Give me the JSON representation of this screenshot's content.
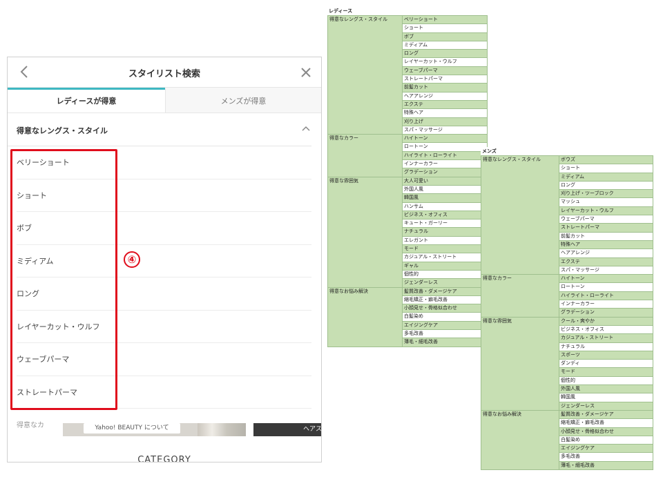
{
  "modal": {
    "title": "スタイリスト検索",
    "tabs": [
      {
        "label": "レディースが得意",
        "active": true
      },
      {
        "label": "メンズが得意",
        "active": false
      }
    ],
    "section_title": "得意なレングス・スタイル",
    "options": [
      "ベリーショート",
      "ショート",
      "ボブ",
      "ミディアム",
      "ロング",
      "レイヤーカット・ウルフ",
      "ウェーブパーマ",
      "ストレートパーマ"
    ],
    "marker": "④",
    "next_section_partial": "得意なカ",
    "footer": {
      "about_label": "Yahoo! BEAUTY について",
      "dark_label": "ヘアス",
      "category_label": "CATEGORY"
    },
    "accent_color": "#3fb8c2",
    "highlight_color": "#e00d1c"
  },
  "ladies_table": {
    "title": "レディース",
    "groups": [
      {
        "category": "得意なレングス・スタイル",
        "items": [
          "ベリーショート",
          "ショート",
          "ボブ",
          "ミディアム",
          "ロング",
          "レイヤーカット・ウルフ",
          "ウェーブパーマ",
          "ストレートパーマ",
          "前髪カット",
          "ヘアアレンジ",
          "エクステ",
          "特殊ヘア",
          "刈り上げ",
          "スパ・マッサージ"
        ]
      },
      {
        "category": "得意なカラー",
        "items": [
          "ハイトーン",
          "ロートーン",
          "ハイライト・ローライト",
          "インナーカラー",
          "グラデーション"
        ]
      },
      {
        "category": "得意な雰囲気",
        "items": [
          "大人可愛い",
          "外国人風",
          "韓国風",
          "ハンサム",
          "ビジネス・オフィス",
          "キュート・ガーリー",
          "ナチュラル",
          "エレガント",
          "モード",
          "カジュアル・ストリート",
          "ギャル",
          "個性的",
          "ジェンダーレス"
        ]
      },
      {
        "category": "得意なお悩み解決",
        "items": [
          "髪質改善・ダメージケア",
          "縮毛矯正・癖毛改善",
          "小顔見せ・骨格似合わせ",
          "白髪染め",
          "エイジングケア",
          "多毛改善",
          "薄毛・細毛改善"
        ]
      }
    ]
  },
  "mens_table": {
    "title": "メンズ",
    "groups": [
      {
        "category": "得意なレングス・スタイル",
        "items": [
          "ボウズ",
          "ショート",
          "ミディアム",
          "ロング",
          "刈り上げ・ツーブロック",
          "マッシュ",
          "レイヤーカット・ウルフ",
          "ウェーブパーマ",
          "ストレートパーマ",
          "前髪カット",
          "特殊ヘア",
          "ヘアアレンジ",
          "エクステ",
          "スパ・マッサージ"
        ]
      },
      {
        "category": "得意なカラー",
        "items": [
          "ハイトーン",
          "ロートーン",
          "ハイライト・ローライト",
          "インナーカラー",
          "グラデーション"
        ]
      },
      {
        "category": "得意な雰囲気",
        "items": [
          "クール・爽やか",
          "ビジネス・オフィス",
          "カジュアル・ストリート",
          "ナチュラル",
          "スポーツ",
          "ダンディ",
          "モード",
          "個性的",
          "外国人風",
          "韓国風",
          "ジェンダーレス"
        ]
      },
      {
        "category": "得意なお悩み解決",
        "items": [
          "髪質改善・ダメージケア",
          "縮毛矯正・癖毛改善",
          "小顔見せ・骨格似合わせ",
          "白髪染め",
          "エイジングケア",
          "多毛改善",
          "薄毛・細毛改善"
        ]
      }
    ]
  }
}
